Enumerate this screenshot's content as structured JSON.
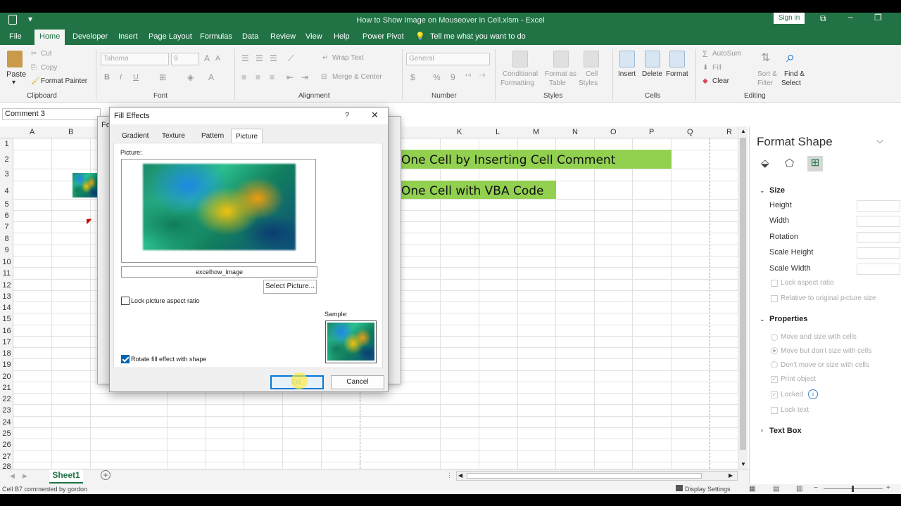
{
  "window": {
    "title": "How to Show Image on Mouseover in Cell.xlsm  -  Excel",
    "signin": "Sign in"
  },
  "ribbon_tabs": [
    {
      "label": "File"
    },
    {
      "label": "Home"
    },
    {
      "label": "Developer"
    },
    {
      "label": "Insert"
    },
    {
      "label": "Page Layout"
    },
    {
      "label": "Formulas"
    },
    {
      "label": "Data"
    },
    {
      "label": "Review"
    },
    {
      "label": "View"
    },
    {
      "label": "Help"
    },
    {
      "label": "Power Pivot"
    }
  ],
  "tell_me": "Tell me what you want to do",
  "ribbon": {
    "clipboard": {
      "paste": "Paste",
      "cut": "Cut",
      "copy": "Copy",
      "format_painter": "Format Painter",
      "group": "Clipboard"
    },
    "font": {
      "name": "Tahoma",
      "size": "9",
      "bold": "B",
      "italic": "I",
      "underline": "U",
      "group": "Font"
    },
    "alignment": {
      "wrap": "Wrap Text",
      "merge": "Merge & Center",
      "group": "Alignment"
    },
    "number": {
      "format": "General",
      "currency": "$",
      "percent": "%",
      "comma": "9",
      "group": "Number"
    },
    "styles": {
      "cond1": "Conditional",
      "cond2": "Formatting",
      "fmt1": "Format as",
      "fmt2": "Table",
      "cell1": "Cell",
      "cell2": "Styles",
      "group": "Styles"
    },
    "cells": {
      "insert": "Insert",
      "delete": "Delete",
      "format": "Format",
      "group": "Cells"
    },
    "editing": {
      "autosum": "AutoSum",
      "fill": "Fill",
      "clear": "Clear",
      "sort1": "Sort &",
      "sort2": "Filter",
      "find1": "Find &",
      "find2": "Select",
      "group": "Editing"
    }
  },
  "name_box": "Comment 3",
  "columns_left": [
    "A",
    "B"
  ],
  "columns_right": [
    "K",
    "L",
    "M",
    "N",
    "O",
    "P",
    "Q",
    "R"
  ],
  "rows": [
    "1",
    "2",
    "3",
    "4",
    "5",
    "6",
    "7",
    "8",
    "9",
    "10",
    "11",
    "12",
    "13",
    "14",
    "15",
    "16",
    "17",
    "18",
    "19",
    "20",
    "21",
    "22",
    "23",
    "24",
    "25",
    "26",
    "27",
    "28"
  ],
  "cells": {
    "row2": "One Cell by Inserting Cell Comment",
    "row4": "One Cell with VBA Code"
  },
  "sheet_tab": "Sheet1",
  "status": {
    "left": "Cell B7 commented by gordon",
    "display_settings": "Display Settings"
  },
  "format_pane": {
    "title": "Format Shape",
    "size_section": "Size",
    "height": "Height",
    "width": "Width",
    "rotation": "Rotation",
    "scale_height": "Scale Height",
    "scale_width": "Scale Width",
    "lock_aspect": "Lock aspect ratio",
    "relative": "Relative to original picture size",
    "properties_section": "Properties",
    "move_size": "Move and size with cells",
    "move_no_size": "Move but don't size with cells",
    "dont_move": "Don't move or size with cells",
    "print_object": "Print object",
    "locked": "Locked",
    "lock_text": "Lock text",
    "textbox_section": "Text Box"
  },
  "dialog_back": {
    "title_fragment": "Fo"
  },
  "dialog": {
    "title": "Fill Effects",
    "help": "?",
    "tabs": [
      "Gradient",
      "Texture",
      "Pattern",
      "Picture"
    ],
    "active_tab": "Picture",
    "picture_label": "Picture:",
    "picture_name": "excelhow_image",
    "select_picture": "Select Picture...",
    "lock_aspect": "Lock picture aspect ratio",
    "lock_aspect_checked": false,
    "sample_label": "Sample:",
    "rotate": "Rotate fill effect with shape",
    "rotate_checked": true,
    "ok": "OK",
    "cancel": "Cancel"
  },
  "colors": {
    "excel_green": "#217346",
    "highlight_green": "#92d050",
    "checkbox_blue": "#0063b1"
  }
}
